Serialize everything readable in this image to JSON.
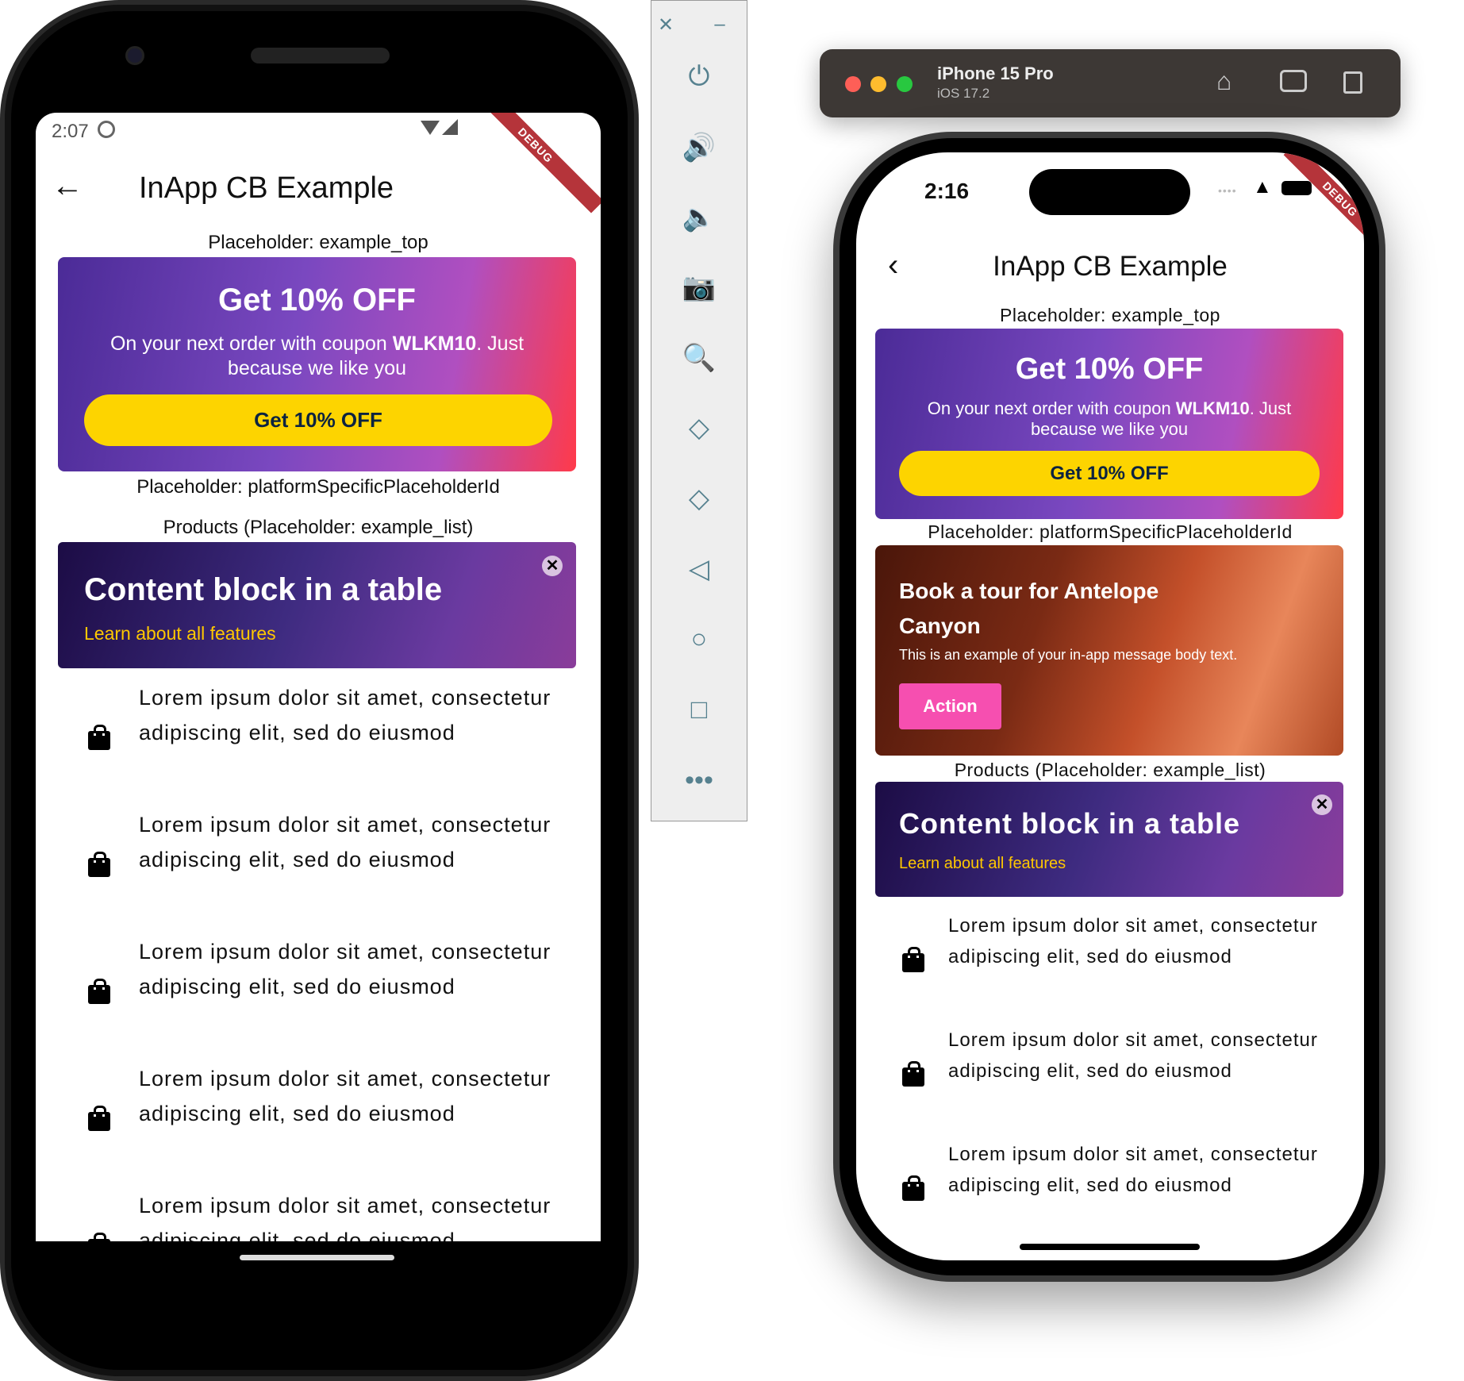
{
  "android": {
    "status_time": "2:07",
    "debug_label": "DEBUG",
    "app_title": "InApp CB Example",
    "placeholder_top": "Placeholder: example_top",
    "banner": {
      "title": "Get 10% OFF",
      "body_prefix": "On your next order with coupon ",
      "coupon": "WLKM10",
      "body_suffix": ". Just because we like you",
      "button": "Get 10% OFF"
    },
    "placeholder_platform": "Placeholder: platformSpecificPlaceholderId",
    "products_label": "Products (Placeholder: example_list)",
    "content_block": {
      "title": "Content block in a table",
      "link": "Learn about all features"
    },
    "items": [
      "Lorem ipsum dolor sit amet, consectetur adipiscing elit, sed do eiusmod",
      "Lorem ipsum dolor sit amet, consectetur adipiscing elit, sed do eiusmod",
      "Lorem ipsum dolor sit amet, consectetur adipiscing elit, sed do eiusmod",
      "Lorem ipsum dolor sit amet, consectetur adipiscing elit, sed do eiusmod",
      "Lorem ipsum dolor sit amet, consectetur adipiscing elit, sed do eiusmod"
    ]
  },
  "emulator_toolbar": {
    "icons": [
      "close-icon",
      "minimize-icon",
      "power-icon",
      "volume-up-icon",
      "volume-down-icon",
      "camera-icon",
      "zoom-icon",
      "rotate-left-icon",
      "rotate-right-icon",
      "back-icon",
      "home-icon",
      "overview-icon",
      "more-icon"
    ]
  },
  "simulator": {
    "device": "iPhone 15 Pro",
    "os": "iOS 17.2",
    "icons": [
      "home-icon",
      "screenshot-icon",
      "rotate-icon"
    ]
  },
  "ios": {
    "status_time": "2:16",
    "debug_label": "DEBUG",
    "app_title": "InApp CB Example",
    "placeholder_top": "Placeholder: example_top",
    "banner": {
      "title": "Get 10% OFF",
      "body_prefix": "On your next order with coupon ",
      "coupon": "WLKM10",
      "body_suffix": ". Just because we like you",
      "button": "Get 10% OFF"
    },
    "placeholder_platform": "Placeholder: platformSpecificPlaceholderId",
    "canyon": {
      "title": "Book a tour for Antelope Canyon",
      "body": "This is an example of your in-app message body text.",
      "button": "Action"
    },
    "products_label": "Products (Placeholder: example_list)",
    "content_block": {
      "title": "Content block in a table",
      "link": "Learn about all features"
    },
    "items": [
      "Lorem ipsum dolor sit amet, consectetur adipiscing elit, sed do eiusmod",
      "Lorem ipsum dolor sit amet, consectetur adipiscing elit, sed do eiusmod",
      "Lorem ipsum dolor sit amet, consectetur adipiscing elit, sed do eiusmod"
    ]
  },
  "colors": {
    "banner_button": "#fdd400",
    "action_button": "#f64fb0",
    "link": "#ffc800",
    "debug": "#b5343a"
  }
}
